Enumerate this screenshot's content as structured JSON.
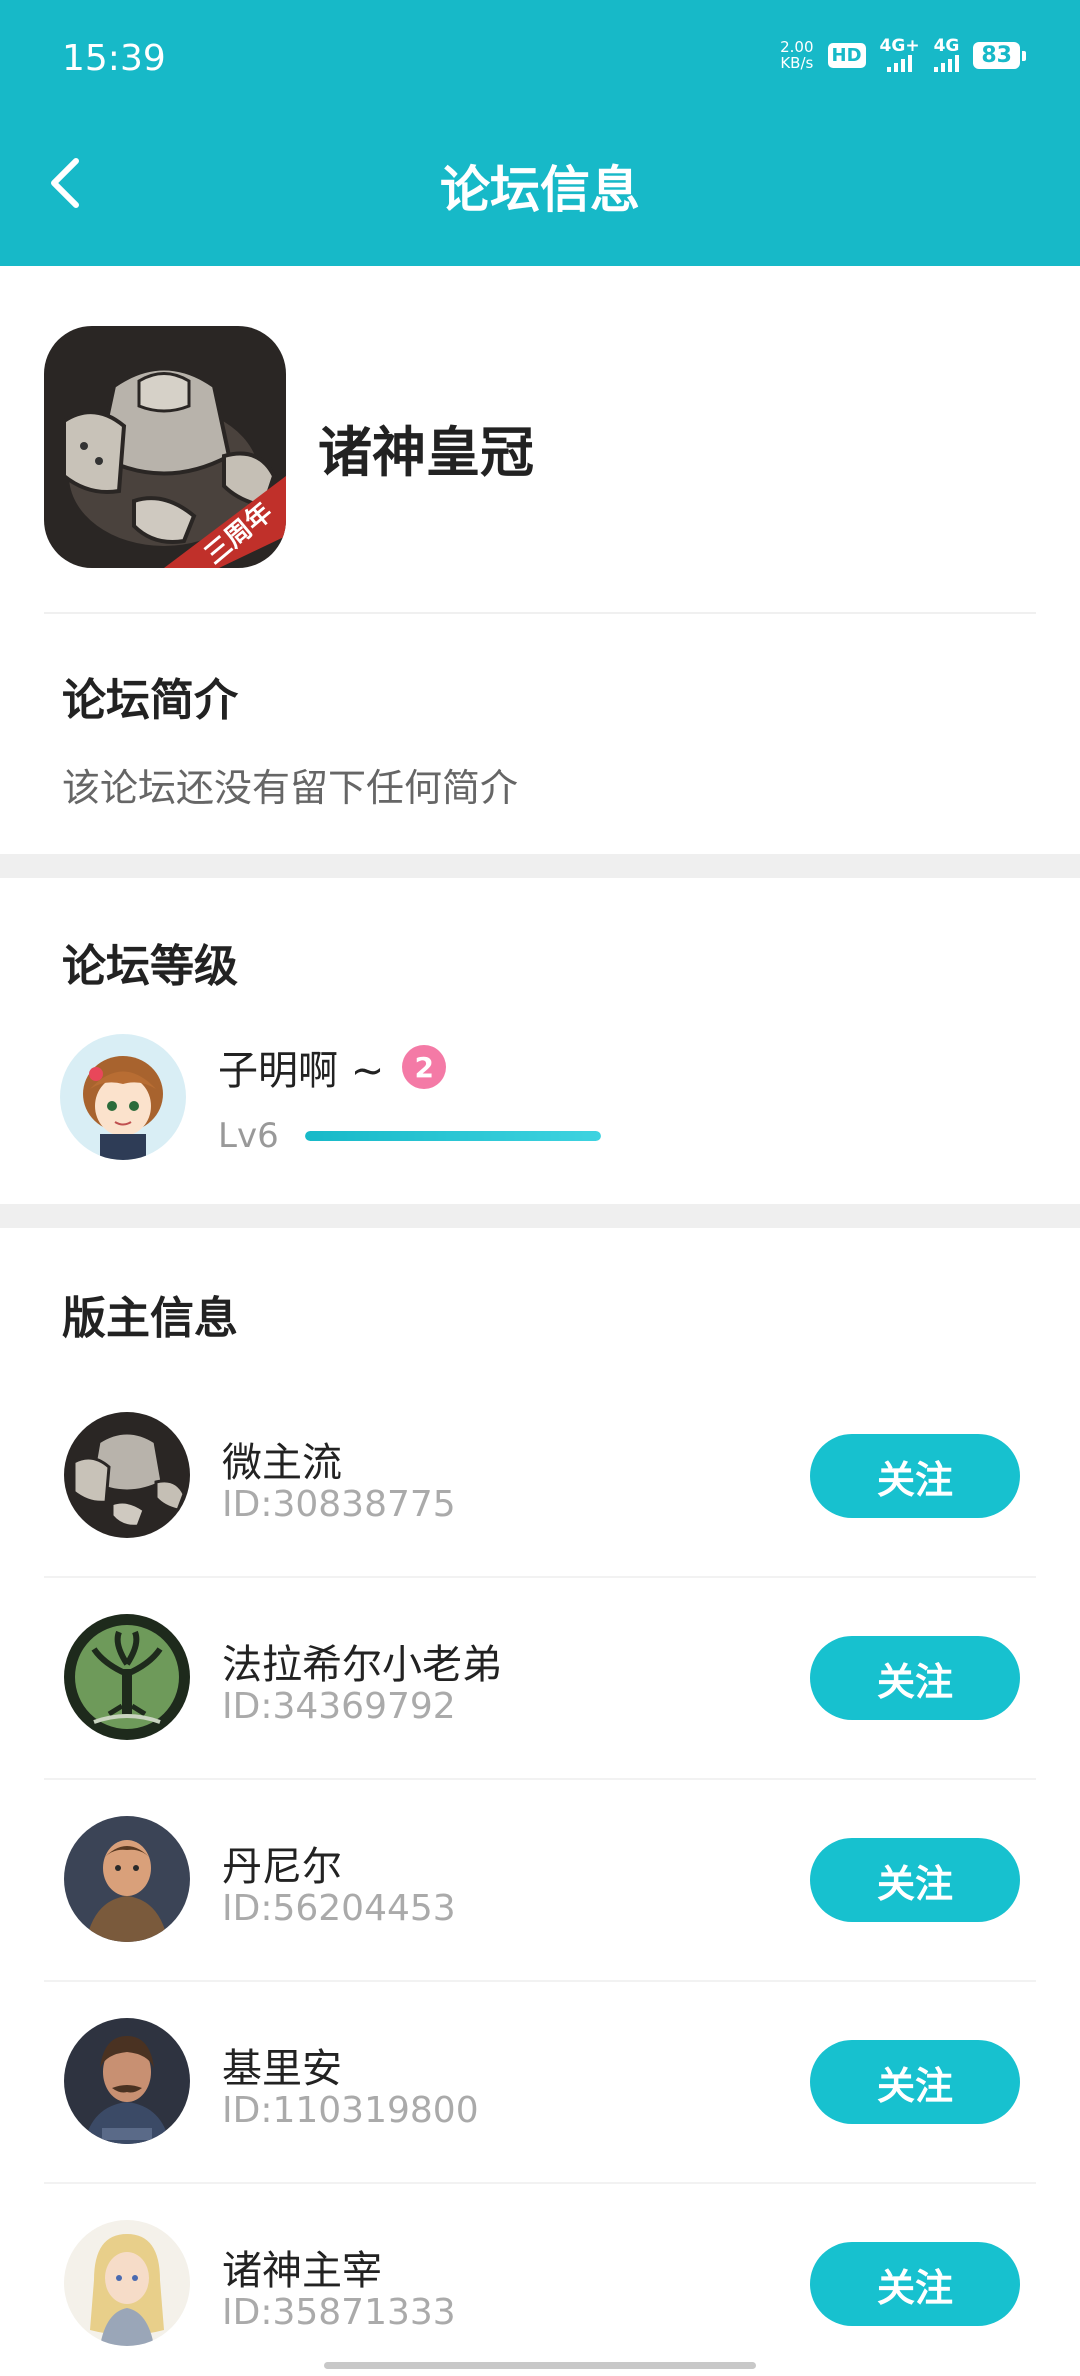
{
  "status_bar": {
    "time": "15:39",
    "net_speed_value": "2.00",
    "net_speed_unit": "KB/s",
    "hd_label": "HD",
    "sim1_label": "4G+",
    "sim2_label": "4G",
    "battery": "83"
  },
  "header": {
    "title": "论坛信息"
  },
  "forum": {
    "name": "诸神皇冠",
    "icon_ribbon_text": "三周年"
  },
  "intro": {
    "title": "论坛简介",
    "text": "该论坛还没有留下任何简介"
  },
  "level": {
    "title": "论坛等级",
    "user_name": "子明啊 ~",
    "badge": "2",
    "level_text": "Lv6",
    "progress": 1.0
  },
  "moderators": {
    "title": "版主信息",
    "follow_label": "关注",
    "items": [
      {
        "name": "微主流",
        "id": "ID:30838775",
        "avatar": "armor-avatar"
      },
      {
        "name": "法拉希尔小老弟",
        "id": "ID:34369792",
        "avatar": "tree-avatar"
      },
      {
        "name": "丹尼尔",
        "id": "ID:56204453",
        "avatar": "knight-avatar"
      },
      {
        "name": "基里安",
        "id": "ID:110319800",
        "avatar": "mustache-avatar"
      },
      {
        "name": "诸神主宰",
        "id": "ID:35871333",
        "avatar": "blonde-avatar"
      }
    ]
  },
  "colors": {
    "accent": "#17b9c8",
    "button": "#17c1cf",
    "badge": "#f47aa6"
  }
}
